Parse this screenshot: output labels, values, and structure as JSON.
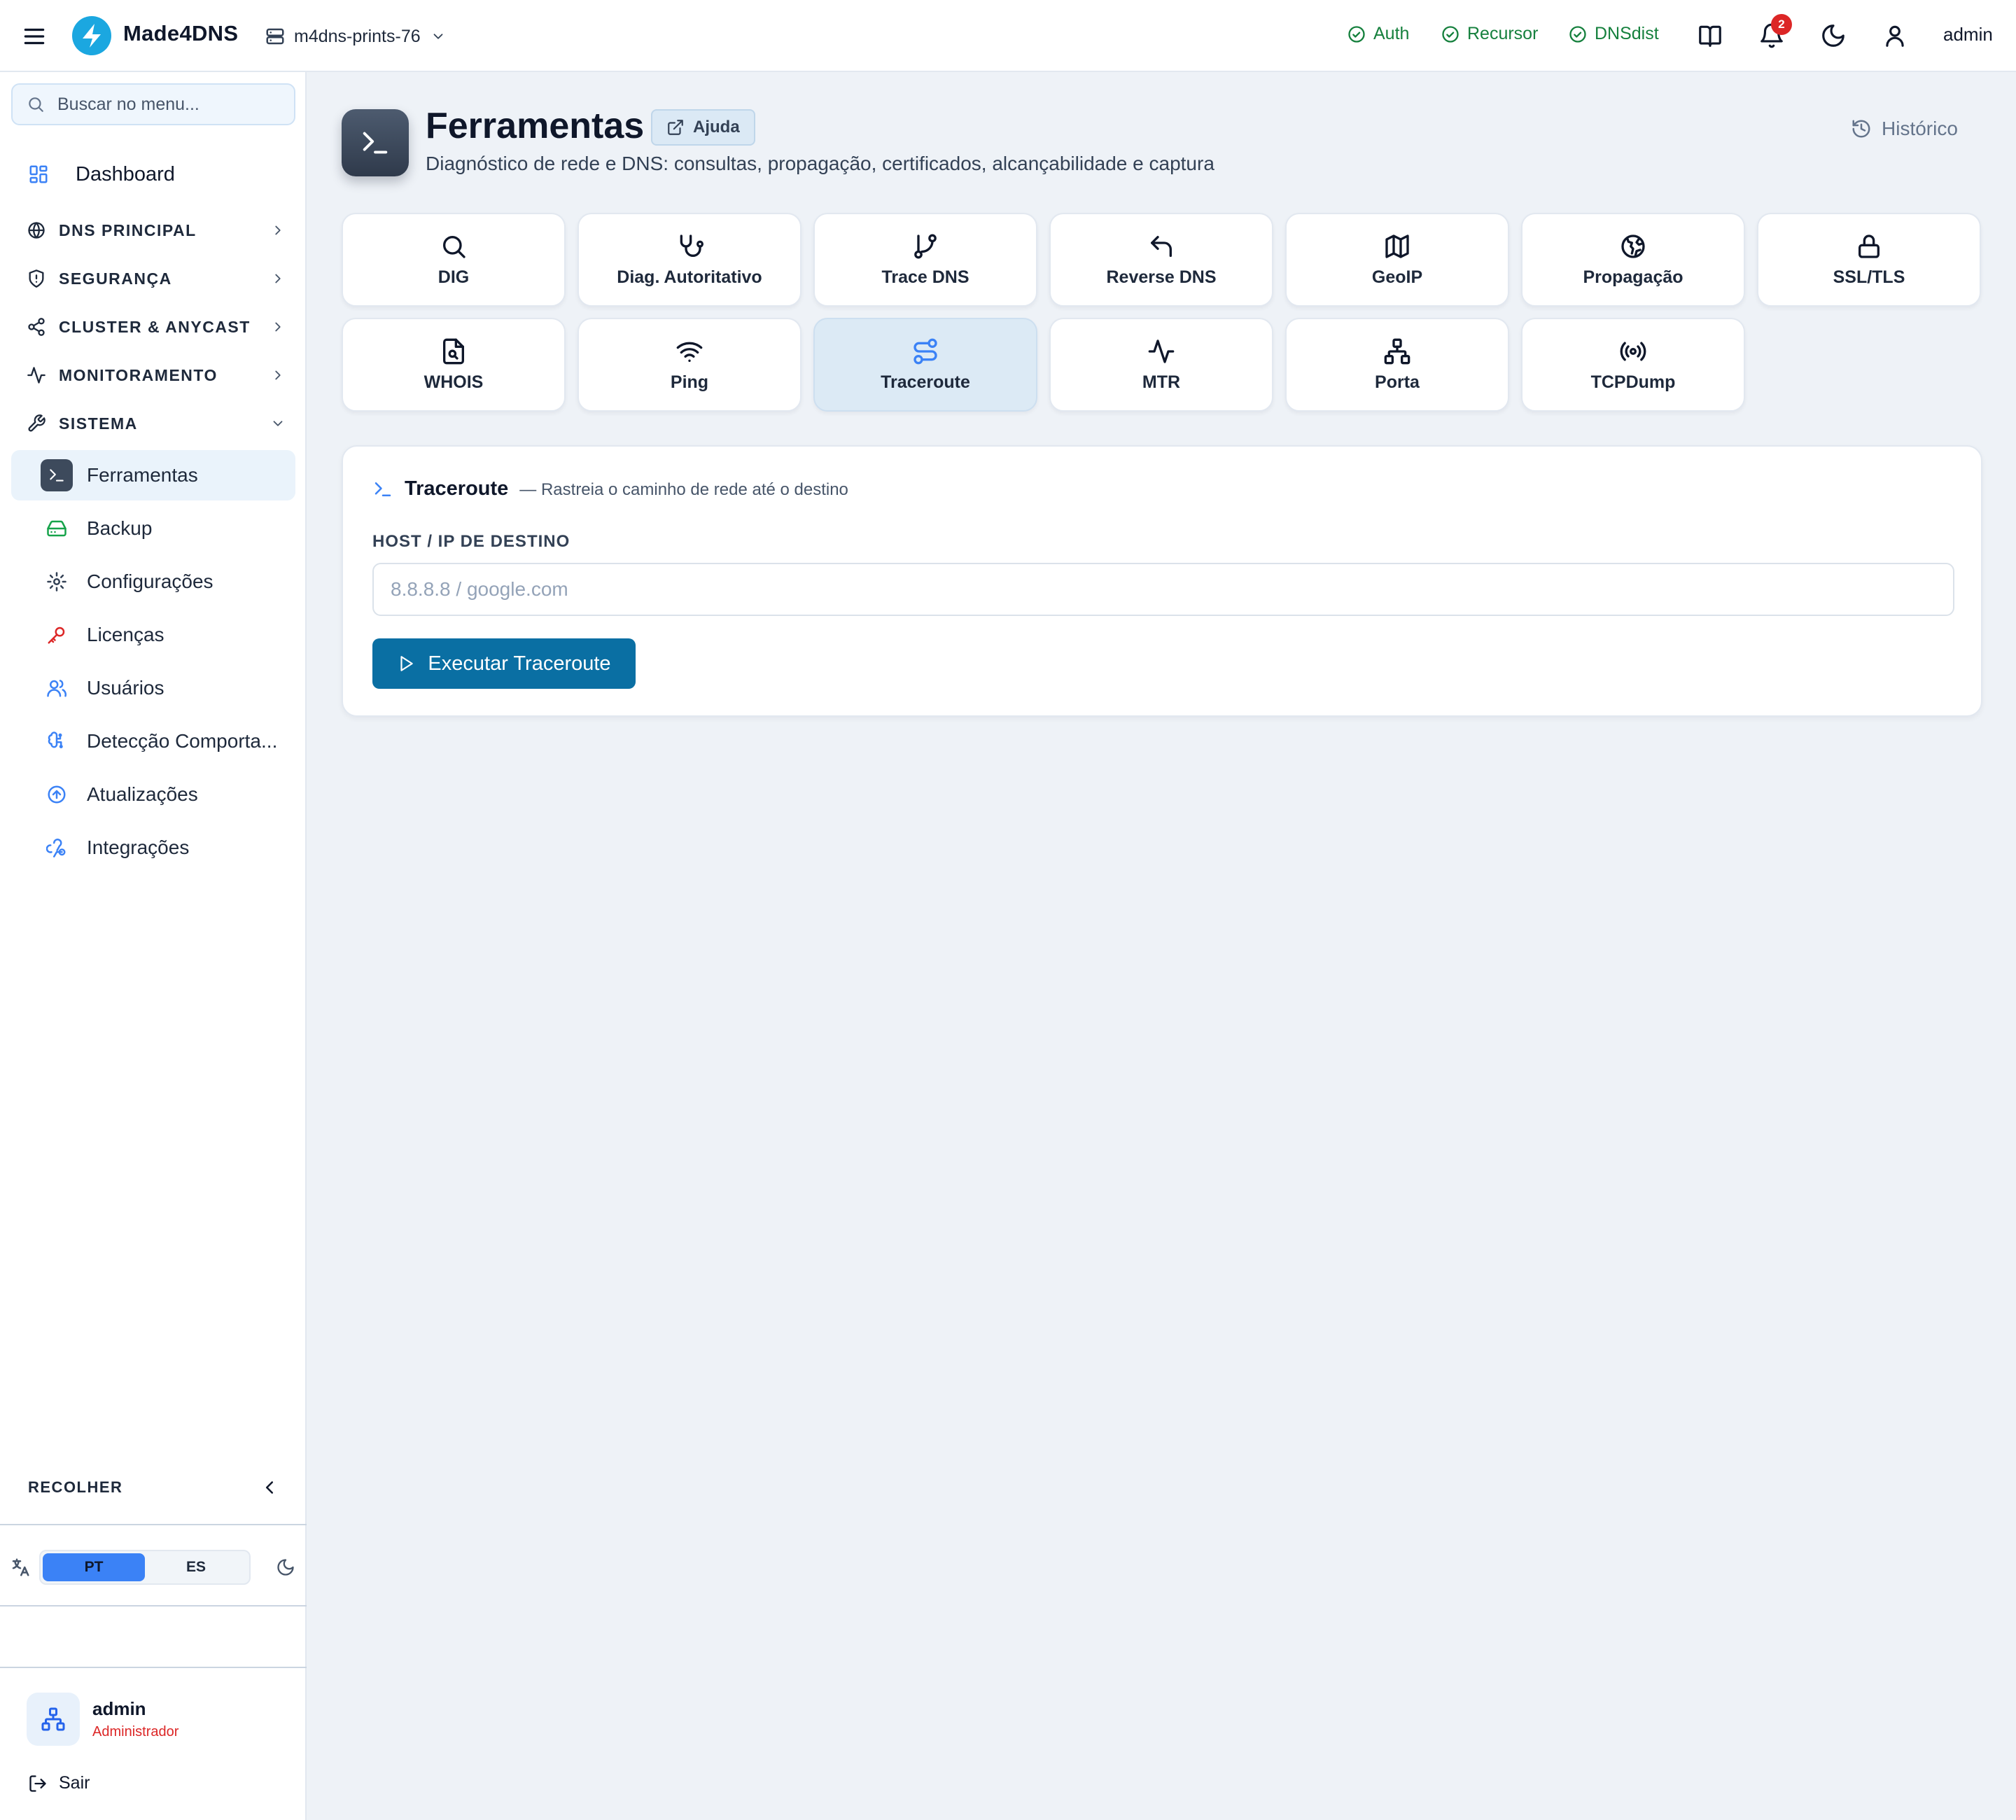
{
  "app": {
    "brand": "Made4DNS",
    "logo_color": "#1ba7e0"
  },
  "server": {
    "name": "m4dns-prints-76",
    "icon": "server-icon"
  },
  "services": [
    {
      "label": "Auth",
      "status": "ok"
    },
    {
      "label": "Recursor",
      "status": "ok"
    },
    {
      "label": "DNSdist",
      "status": "ok"
    }
  ],
  "notifications": {
    "count": "2"
  },
  "top_user": "admin",
  "sidebar": {
    "search_placeholder": "Buscar no menu...",
    "dashboard": "Dashboard",
    "sections": [
      {
        "label": "DNS PRINCIPAL",
        "icon": "globe-icon",
        "expanded": false
      },
      {
        "label": "SEGURANÇA",
        "icon": "shield-icon",
        "expanded": false
      },
      {
        "label": "CLUSTER & ANYCAST",
        "icon": "share-icon",
        "expanded": false
      },
      {
        "label": "MONITORAMENTO",
        "icon": "activity-icon",
        "expanded": false
      },
      {
        "label": "SISTEMA",
        "icon": "wrench-icon",
        "expanded": true
      }
    ],
    "items": [
      {
        "label": "Ferramentas",
        "icon": "terminal-icon",
        "active": true
      },
      {
        "label": "Backup",
        "icon": "hard-drive-icon",
        "active": false
      },
      {
        "label": "Configurações",
        "icon": "gear-icon",
        "active": false
      },
      {
        "label": "Licenças",
        "icon": "key-icon",
        "active": false
      },
      {
        "label": "Usuários",
        "icon": "users-icon",
        "active": false
      },
      {
        "label": "Detecção Comporta...",
        "icon": "brain-icon",
        "active": false
      },
      {
        "label": "Atualizações",
        "icon": "upload-circle-icon",
        "active": false
      },
      {
        "label": "Integrações",
        "icon": "webhook-icon",
        "active": false
      }
    ],
    "collapse_label": "RECOLHER",
    "languages": [
      "PT",
      "ES"
    ],
    "selected_language": "PT",
    "user": {
      "name": "admin",
      "role": "Administrador"
    },
    "logout": "Sair"
  },
  "page": {
    "title": "Ferramentas",
    "help": "Ajuda",
    "subtitle": "Diagnóstico de rede e DNS: consultas, propagação, certificados, alcançabilidade e captura",
    "history": "Histórico"
  },
  "tools": [
    {
      "label": "DIG",
      "icon": "search-icon"
    },
    {
      "label": "Diag. Autoritativo",
      "icon": "stethoscope-icon"
    },
    {
      "label": "Trace DNS",
      "icon": "git-branch-icon"
    },
    {
      "label": "Reverse DNS",
      "icon": "undo-arrow-icon"
    },
    {
      "label": "GeoIP",
      "icon": "map-icon"
    },
    {
      "label": "Propagação",
      "icon": "globe-icon"
    },
    {
      "label": "SSL/TLS",
      "icon": "lock-icon"
    },
    {
      "label": "WHOIS",
      "icon": "file-search-icon"
    },
    {
      "label": "Ping",
      "icon": "wifi-icon"
    },
    {
      "label": "Traceroute",
      "icon": "route-icon",
      "active": true
    },
    {
      "label": "MTR",
      "icon": "activity-icon"
    },
    {
      "label": "Porta",
      "icon": "network-icon"
    },
    {
      "label": "TCPDump",
      "icon": "radio-icon"
    }
  ],
  "panel": {
    "title": "Traceroute",
    "description": "— Rastreia o caminho de rede até o destino",
    "field_label": "HOST / IP DE DESTINO",
    "placeholder": "8.8.8.8 / google.com",
    "value": "",
    "run_label": "Executar Traceroute"
  },
  "colors": {
    "accent": "#3b82f6",
    "primary_button": "#0a6fa3",
    "status_ok": "#15803d",
    "badge": "#dc2626"
  }
}
